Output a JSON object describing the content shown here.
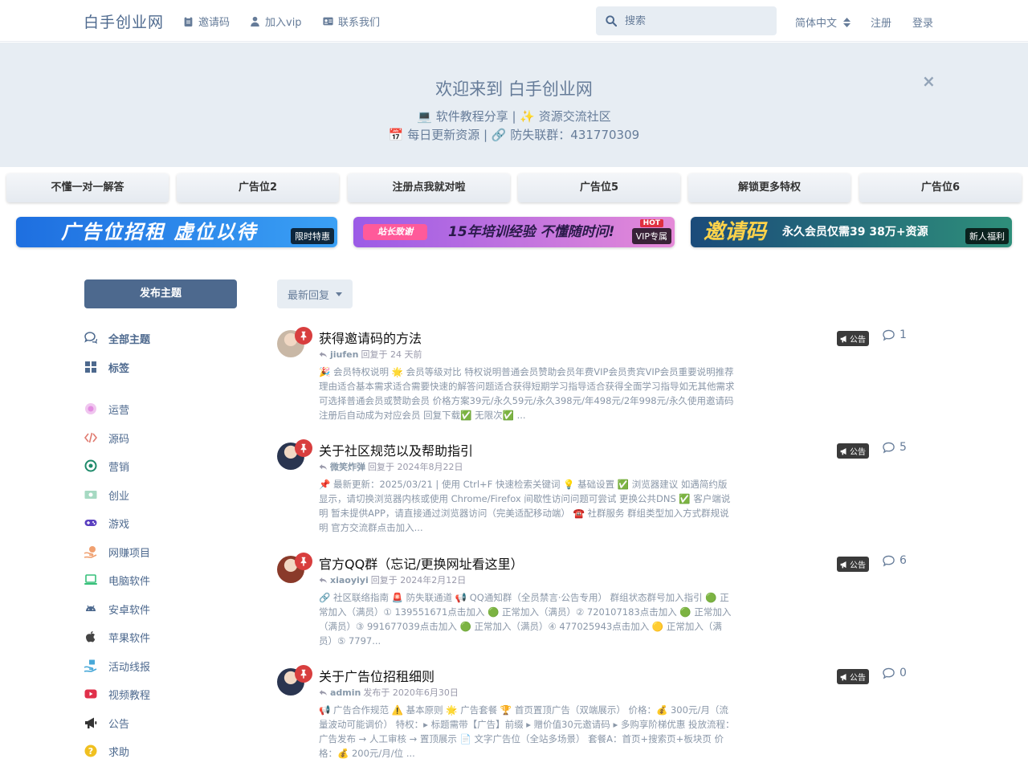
{
  "header": {
    "logo": "白手创业网",
    "nav": [
      {
        "label": "邀请码",
        "icon": "clipboard-icon"
      },
      {
        "label": "加入vip",
        "icon": "user-icon"
      },
      {
        "label": "联系我们",
        "icon": "id-card-icon"
      }
    ],
    "search_placeholder": "搜索",
    "language": "简体中文",
    "signup": "注册",
    "login": "登录"
  },
  "hero": {
    "title": "欢迎来到 白手创业网",
    "line1": "💻 软件教程分享 | ✨ 资源交流社区",
    "line2": "📅 每日更新资源 | 🔗 防失联群：431770309",
    "close": "×"
  },
  "ad_buttons": [
    "不懂一对一解答",
    "广告位2",
    "注册点我就对啦",
    "广告位5",
    "解锁更多特权",
    "广告位6"
  ],
  "banners": [
    {
      "text": "广告位招租  虚位以待",
      "tag": "限时特惠",
      "colors": [
        "#1e6fe0",
        "#3aa0f5"
      ]
    },
    {
      "badge": "站长致谢",
      "text": "15年培训经验 不懂随时问!",
      "hot": "HOT",
      "tag": "VIP专属",
      "colors": [
        "#9b5be6",
        "#e58ad8"
      ]
    },
    {
      "text": "邀请码",
      "subtext": "永久会员仅需39 38万+资源",
      "tag": "新人福利",
      "colors": [
        "#1b4b7a",
        "#2e8f7a"
      ]
    }
  ],
  "sidebar": {
    "post_button": "发布主题",
    "items": [
      {
        "label": "全部主题",
        "icon": "comments-icon",
        "color": "#4d698e"
      },
      {
        "label": "标签",
        "icon": "grid-icon",
        "color": "#4d698e"
      },
      {
        "label": "运营",
        "icon": "circle-icon",
        "color": "#e28de0"
      },
      {
        "label": "源码",
        "icon": "code-icon",
        "color": "#e07a6f"
      },
      {
        "label": "营销",
        "icon": "target-icon",
        "color": "#1e8a6a"
      },
      {
        "label": "创业",
        "icon": "money-icon",
        "color": "#6bbf9a"
      },
      {
        "label": "游戏",
        "icon": "gamepad-icon",
        "color": "#5a3fc0"
      },
      {
        "label": "网赚项目",
        "icon": "hand-coin-icon",
        "color": "#f0a070"
      },
      {
        "label": "电脑软件",
        "icon": "laptop-icon",
        "color": "#37c07a"
      },
      {
        "label": "安卓软件",
        "icon": "android-icon",
        "color": "#4d698e"
      },
      {
        "label": "苹果软件",
        "icon": "apple-icon",
        "color": "#444444"
      },
      {
        "label": "活动线报",
        "icon": "hand-gift-icon",
        "color": "#48a8d8"
      },
      {
        "label": "视频教程",
        "icon": "youtube-icon",
        "color": "#e0304a"
      },
      {
        "label": "公告",
        "icon": "bullhorn-icon",
        "color": "#333333"
      },
      {
        "label": "求助",
        "icon": "question-icon",
        "color": "#f0c020"
      }
    ]
  },
  "sort": {
    "label": "最新回复"
  },
  "discussions": [
    {
      "title": "获得邀请码的方法",
      "user": "jiufen",
      "action": "回复于 24 天前",
      "excerpt": "🎉 会员特权说明 🌟 会员等级对比 特权说明普通会员赞助会员年费VIP会员贵宾VIP会员重要说明推荐理由适合基本需求适合需要快速的解答问题适合获得短期学习指导适合获得全面学习指导如无其他需求可选择普通会员或赞助会员 价格方案39元/永久59元/永久398元/年498元/2年998元/永久使用邀请码注册后自动成为对应会员 回复下载✅ 无限次✅ ...",
      "tag": "公告",
      "replies": "1",
      "avatar_color": "#c9b8a6"
    },
    {
      "title": "关于社区规范以及帮助指引",
      "user": "微笑炸弹",
      "action": "回复于 2024年8月22日",
      "excerpt": "📌 最新更新：2025/03/21 | 使用 Ctrl+F 快速检索关键词 💡 基础设置 ✅ 浏览器建议 如遇简约版显示，请切换浏览器内核或使用 Chrome/Firefox 间歇性访问问题可尝试 更换公共DNS ✅ 客户端说明 暂未提供APP，请直接通过浏览器访问（完美适配移动端） ☎️ 社群服务 群组类型加入方式群规说明 官方交流群点击加入...",
      "tag": "公告",
      "replies": "5",
      "avatar_color": "#2a3550"
    },
    {
      "title": "官方QQ群（忘记/更换网址看这里）",
      "user": "xiaoyiyi",
      "action": "回复于 2024年2月12日",
      "excerpt": "🔗 社区联络指南 🚨 防失联通道 📢 QQ通知群（全员禁言·公告专用） 群组状态群号加入指引 🟢 正常加入（满员）① 139551671点击加入 🟢 正常加入（满员）② 720107183点击加入 🟢 正常加入（满员）③ 991677039点击加入 🟢 正常加入（满员）④ 477025943点击加入 🟡 正常加入（满员）⑤ 7797...",
      "tag": "公告",
      "replies": "6",
      "avatar_color": "#8a3a2a"
    },
    {
      "title": "关于广告位招租细则",
      "user": "admin",
      "action": "发布于 2020年6月30日",
      "excerpt": "📢 广告合作规范 ⚠️ 基本原则 🌟 广告套餐 🏆 首页置顶广告（双端展示） 价格：💰 300元/月（流量波动可能调价） 特权：▸ 标题需带【广告】前缀 ▸ 赠价值30元邀请码 ▸ 多购享阶梯优惠 投放流程： 广告发布 → 人工审核 → 置顶展示 📄 文字广告位（全站多场景） 套餐A：首页+搜索页+板块页 价格：💰 200元/月/位 ...",
      "tag": "公告",
      "replies": "0",
      "avatar_color": "#2a3550"
    }
  ]
}
